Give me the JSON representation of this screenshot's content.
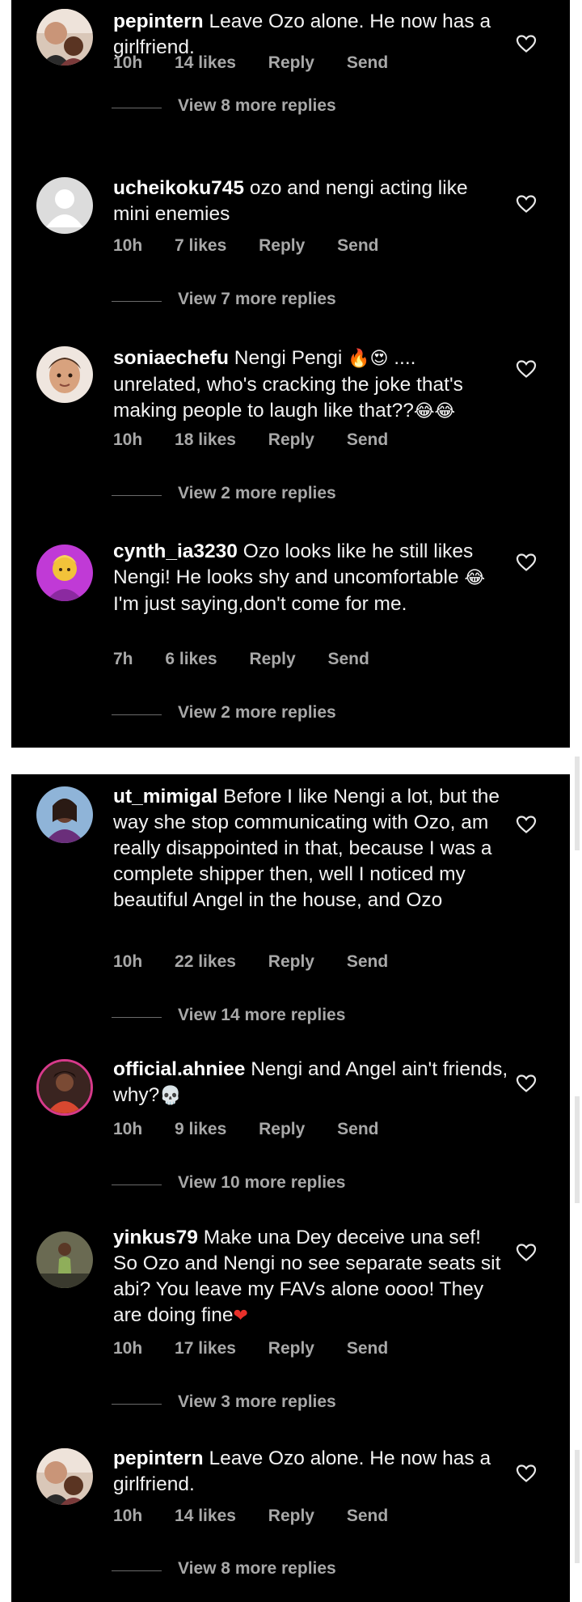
{
  "icons": {
    "like": "heart-outline-icon"
  },
  "colors": {
    "background": "#000000",
    "text": "#f2f2f2",
    "meta": "#a8a8a8"
  },
  "screens": [
    {
      "comments": [
        {
          "username": "pepintern",
          "text": "Leave Ozo alone. He now has a girlfriend.",
          "emoji": "",
          "time": "10h",
          "likes": "14 likes",
          "reply": "Reply",
          "send": "Send",
          "more_replies": "View 8 more replies"
        },
        {
          "username": "ucheikoku745",
          "text": "ozo and nengi acting like mini enemies",
          "emoji": "",
          "time": "10h",
          "likes": "7 likes",
          "reply": "Reply",
          "send": "Send",
          "more_replies": "View 7 more replies"
        },
        {
          "username": "soniaechefu",
          "text": "Nengi Pengi",
          "emoji_a": "🔥😍",
          "text_b": " .... unrelated, who's cracking the joke that's making people to laugh like that??",
          "emoji": "😂😂",
          "time": "10h",
          "likes": "18 likes",
          "reply": "Reply",
          "send": "Send",
          "more_replies": "View 2 more replies"
        },
        {
          "username": "cynth_ia3230",
          "text": "Ozo looks like he still likes Nengi! He looks shy and uncomfortable",
          "emoji_a": "😂",
          "text_b": "I'm just saying,don't come for me.",
          "emoji": "",
          "time": "7h",
          "likes": "6 likes",
          "reply": "Reply",
          "send": "Send",
          "more_replies": "View 2 more replies"
        }
      ]
    },
    {
      "comments": [
        {
          "username": "ut_mimigal",
          "text": "Before I like Nengi a lot, but the way she stop communicating with Ozo, am really disappointed in that, because I was a complete shipper then, well I noticed my beautiful Angel in the house, and  Ozo",
          "emoji": "",
          "time": "10h",
          "likes": "22 likes",
          "reply": "Reply",
          "send": "Send",
          "more_replies": "View 14 more replies"
        },
        {
          "username": "official.ahniee",
          "text": "Nengi and Angel ain't friends, why?",
          "emoji": "💀",
          "time": "10h",
          "likes": "9 likes",
          "reply": "Reply",
          "send": "Send",
          "more_replies": "View 10 more replies"
        },
        {
          "username": "yinkus79",
          "text": "Make una Dey deceive una sef! So Ozo and Nengi no see separate seats sit abi? You leave my FAVs alone oooo! They are doing fine",
          "emoji": "❤",
          "time": "10h",
          "likes": "17 likes",
          "reply": "Reply",
          "send": "Send",
          "more_replies": "View 3 more replies"
        },
        {
          "username": "pepintern",
          "text": "Leave Ozo alone. He now has a girlfriend.",
          "emoji": "",
          "time": "10h",
          "likes": "14 likes",
          "reply": "Reply",
          "send": "Send",
          "more_replies": "View 8 more replies"
        }
      ]
    }
  ]
}
